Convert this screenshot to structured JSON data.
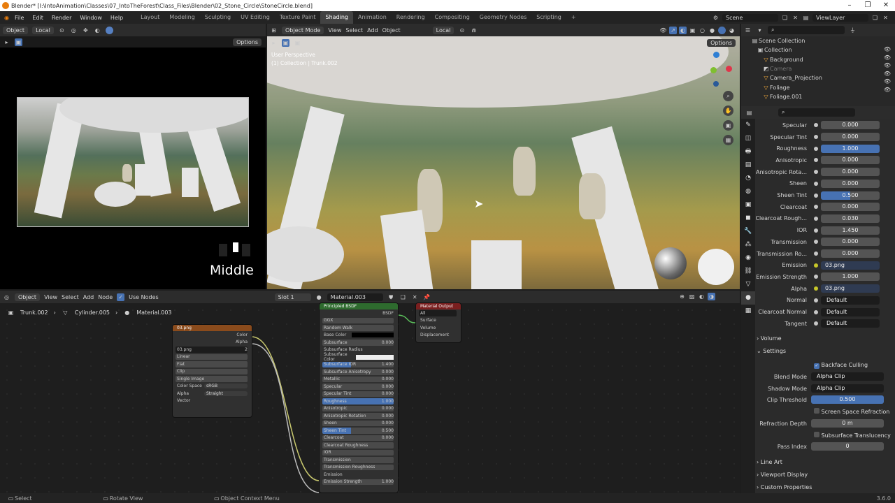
{
  "window": {
    "title": "Blender* [I:\\IntoAnimation\\Classes\\07_IntoTheForest\\Class_Files\\Blender\\02_Stone_Circle\\StoneCircle.blend]"
  },
  "menu": {
    "items": [
      "File",
      "Edit",
      "Render",
      "Window",
      "Help"
    ],
    "workspaces": [
      "Layout",
      "Modeling",
      "Sculpting",
      "UV Editing",
      "Texture Paint",
      "Shading",
      "Animation",
      "Rendering",
      "Compositing",
      "Geometry Nodes",
      "Scripting"
    ],
    "active_workspace": "Shading",
    "scene": "Scene",
    "view_layer": "ViewLayer"
  },
  "left_view": {
    "mode": "Object",
    "orientation": "Local",
    "options": "Options",
    "caption": "Middle"
  },
  "viewport": {
    "mode": "Object Mode",
    "menus": [
      "View",
      "Select",
      "Add",
      "Object"
    ],
    "orientation": "Local",
    "options": "Options",
    "info_line1": "User Perspective",
    "info_line2": "(1) Collection | Trunk.002"
  },
  "node_editor": {
    "mode": "Object",
    "menus": [
      "View",
      "Select",
      "Add",
      "Node"
    ],
    "use_nodes": "Use Nodes",
    "slot": "Slot 1",
    "material": "Material.003",
    "breadcrumb": [
      "Trunk.002",
      "Cylinder.005",
      "Material.003"
    ],
    "image_node": {
      "title": "03.png",
      "outputs": [
        "Color",
        "Alpha"
      ],
      "image": "03.png",
      "users": "2",
      "interp": "Linear",
      "proj": "Flat",
      "ext": "Clip",
      "source": "Single Image",
      "color_space_label": "Color Space",
      "color_space": "sRGB",
      "alpha_label": "Alpha",
      "alpha": "Straight",
      "vector": "Vector"
    },
    "bsdf_node": {
      "title": "Principled BSDF",
      "output": "BSDF",
      "dist": "GGX",
      "sss": "Random Walk",
      "rows": [
        [
          "Base Color",
          ""
        ],
        [
          "Subsurface",
          "0.000"
        ],
        [
          "Subsurface Radius",
          ""
        ],
        [
          "Subsurface Color",
          ""
        ],
        [
          "Subsurface IOR",
          "1.400"
        ],
        [
          "Subsurface Anisotropy",
          "0.000"
        ],
        [
          "Metallic",
          "0.000"
        ],
        [
          "Specular",
          "0.000"
        ],
        [
          "Specular Tint",
          "0.000"
        ],
        [
          "Roughness",
          "1.000"
        ],
        [
          "Anisotropic",
          "0.000"
        ],
        [
          "Anisotropic Rotation",
          "0.000"
        ],
        [
          "Sheen",
          "0.000"
        ],
        [
          "Sheen Tint",
          "0.500"
        ],
        [
          "Clearcoat",
          "0.000"
        ],
        [
          "Clearcoat Roughness",
          ""
        ],
        [
          "IOR",
          ""
        ],
        [
          "Transmission",
          ""
        ],
        [
          "Transmission Roughness",
          ""
        ],
        [
          "Emission",
          ""
        ],
        [
          "Emission Strength",
          "1.000"
        ]
      ]
    },
    "output_node": {
      "title": "Material Output",
      "target": "All",
      "inputs": [
        "Surface",
        "Volume",
        "Displacement"
      ]
    }
  },
  "outliner": {
    "root": "Scene Collection",
    "items": [
      "Collection",
      "Background",
      "Camera",
      "Camera_Projection",
      "Foliage",
      "Foliage.001"
    ]
  },
  "properties": {
    "rows": [
      [
        "Specular",
        "0.000"
      ],
      [
        "Specular Tint",
        "0.000"
      ],
      [
        "Roughness",
        "1.000"
      ],
      [
        "Anisotropic",
        "0.000"
      ],
      [
        "Anisotropic Rota...",
        "0.000"
      ],
      [
        "Sheen",
        "0.000"
      ],
      [
        "Sheen Tint",
        "0.500"
      ],
      [
        "Clearcoat",
        "0.000"
      ],
      [
        "Clearcoat Rough...",
        "0.030"
      ],
      [
        "IOR",
        "1.450"
      ],
      [
        "Transmission",
        "0.000"
      ],
      [
        "Transmission Ro...",
        "0.000"
      ],
      [
        "Emission",
        "03.png"
      ],
      [
        "Emission Strength",
        "1.000"
      ],
      [
        "Alpha",
        "03.png"
      ],
      [
        "Normal",
        "Default"
      ],
      [
        "Clearcoat Normal",
        "Default"
      ],
      [
        "Tangent",
        "Default"
      ]
    ],
    "volume": "Volume",
    "settings": "Settings",
    "backface": "Backface Culling",
    "blend_mode_label": "Blend Mode",
    "blend_mode": "Alpha Clip",
    "shadow_mode_label": "Shadow Mode",
    "shadow_mode": "Alpha Clip",
    "clip_threshold_label": "Clip Threshold",
    "clip_threshold": "0.500",
    "ssr": "Screen Space Refraction",
    "refraction_depth_label": "Refraction Depth",
    "refraction_depth": "0 m",
    "sst": "Subsurface Translucency",
    "pass_index_label": "Pass Index",
    "pass_index": "0",
    "line_art": "Line Art",
    "viewport_display": "Viewport Display",
    "custom_props": "Custom Properties"
  },
  "status": {
    "select": "Select",
    "rotate": "Rotate View",
    "context": "Object Context Menu",
    "version": "3.6.0"
  },
  "colors": {
    "accent": "#4772b3",
    "orange": "#e87d0d",
    "bsdf_header": "#2e6b2e",
    "image_header": "#8a4b1c",
    "output_header": "#7a1f1f"
  }
}
